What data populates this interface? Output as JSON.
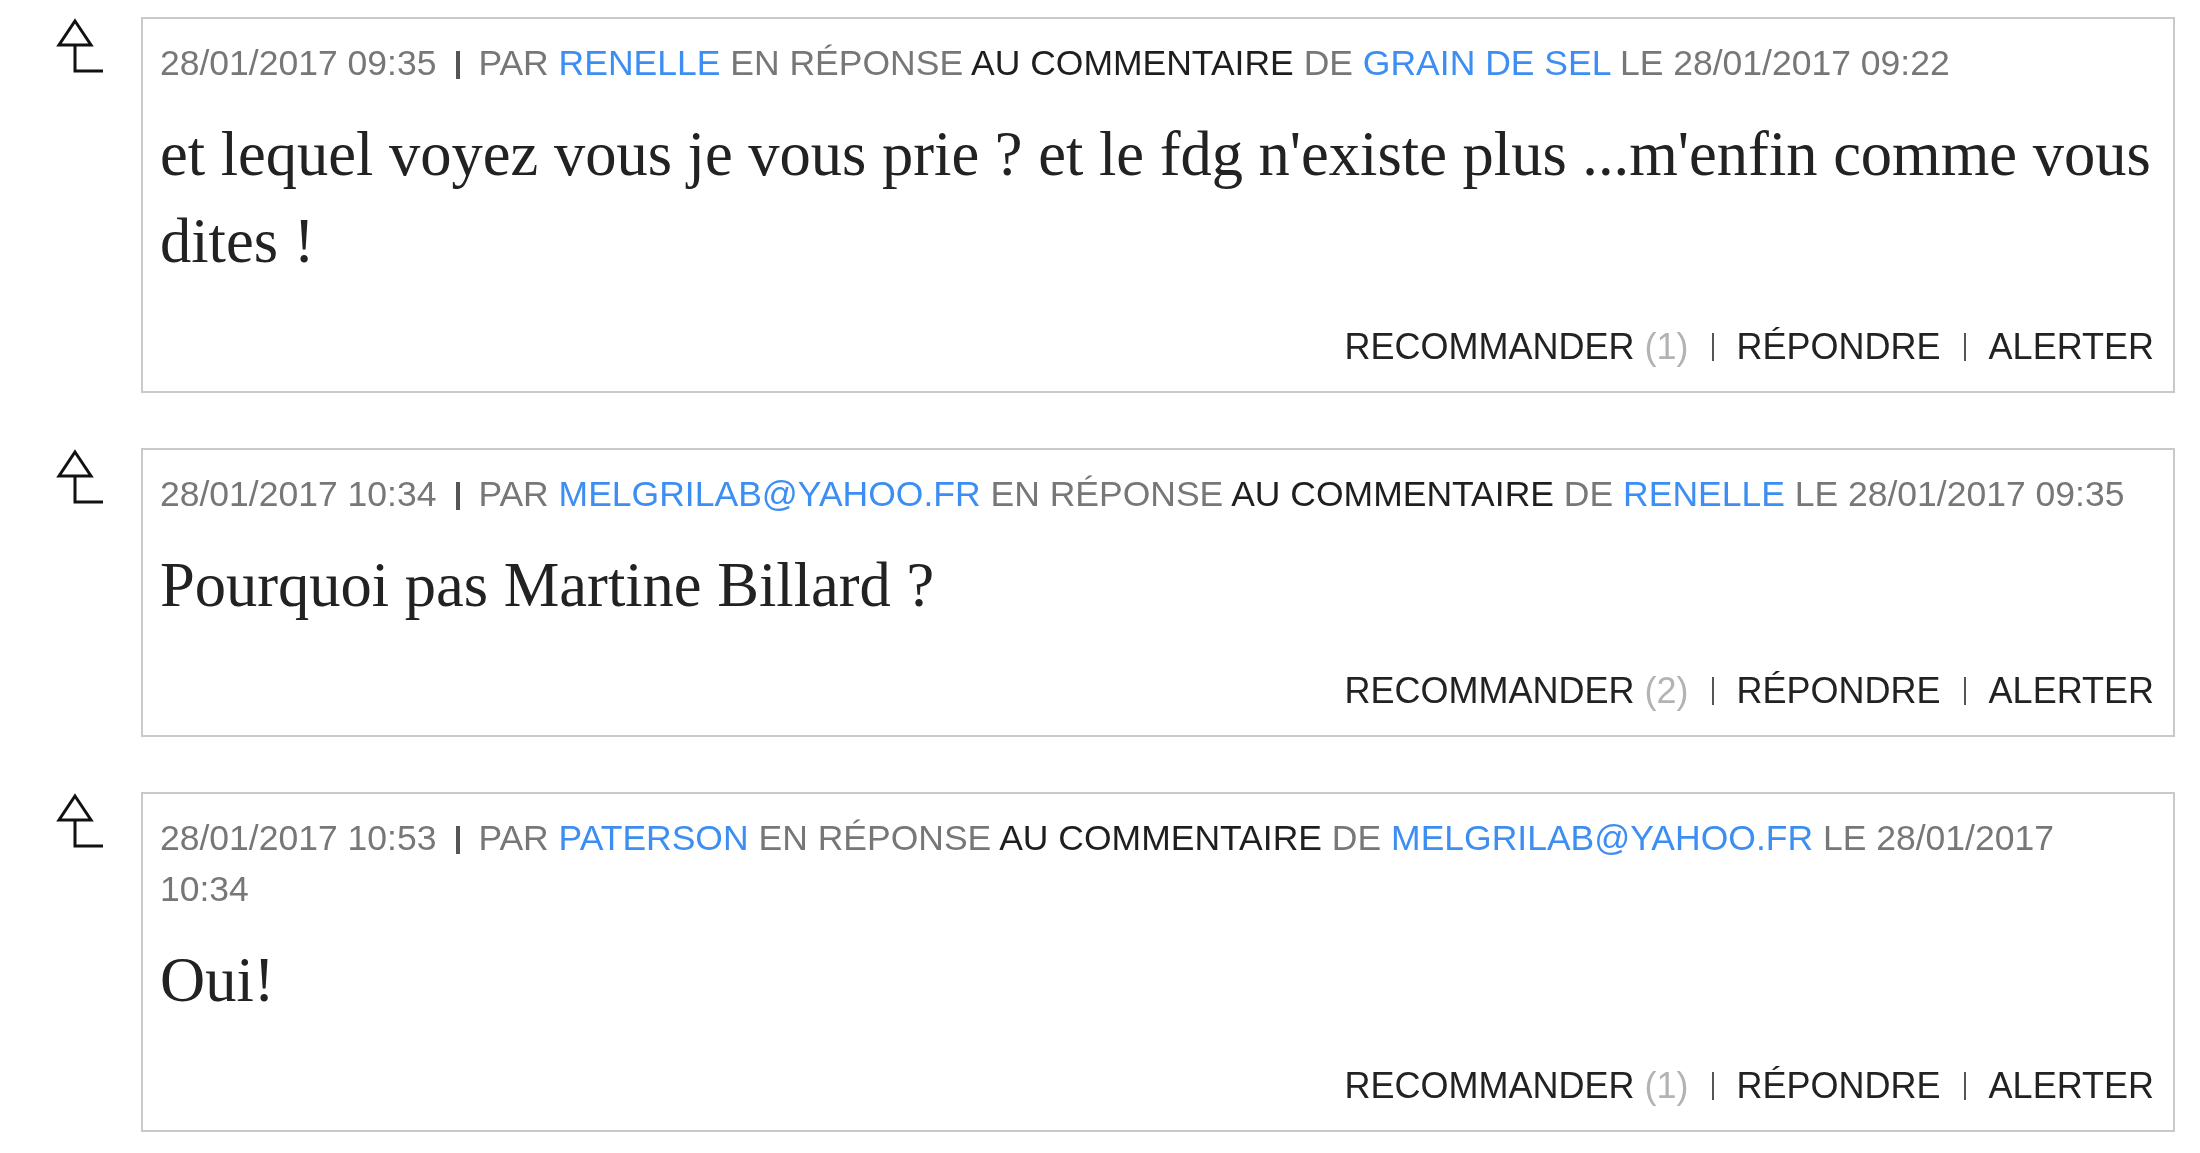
{
  "comments": [
    {
      "timestamp": "28/01/2017 09:35",
      "reply_info": [
        {
          "kind": "text",
          "text": "PAR"
        },
        {
          "kind": "user",
          "text": "RENELLE"
        },
        {
          "kind": "text",
          "text": "EN RÉPONSE"
        },
        {
          "kind": "link",
          "text": "AU COMMENTAIRE"
        },
        {
          "kind": "text",
          "text": "DE"
        },
        {
          "kind": "user",
          "text": "GRAIN DE SEL"
        },
        {
          "kind": "text",
          "text": "LE 28/01/2017 09:22"
        }
      ],
      "body": "et lequel voyez vous je vous prie ? et le fdg n'existe plus ...m'enfin comme vous dites !",
      "actions": [
        {
          "label": "RECOMMANDER",
          "count": "(1)"
        },
        {
          "label": "RÉPONDRE"
        },
        {
          "label": "ALERTER"
        }
      ]
    },
    {
      "timestamp": "28/01/2017 10:34",
      "reply_info": [
        {
          "kind": "text",
          "text": "PAR"
        },
        {
          "kind": "user",
          "text": "MELGRILAB@YAHOO.FR"
        },
        {
          "kind": "text",
          "text": "EN RÉPONSE"
        },
        {
          "kind": "link",
          "text": "AU COMMENTAIRE"
        },
        {
          "kind": "text",
          "text": "DE"
        },
        {
          "kind": "user",
          "text": "RENELLE"
        },
        {
          "kind": "text",
          "text": "LE 28/01/2017 09:35"
        }
      ],
      "body": "Pourquoi pas Martine Billard ?",
      "actions": [
        {
          "label": "RECOMMANDER",
          "count": "(2)"
        },
        {
          "label": "RÉPONDRE"
        },
        {
          "label": "ALERTER"
        }
      ]
    },
    {
      "timestamp": "28/01/2017 10:53",
      "reply_info": [
        {
          "kind": "text",
          "text": "PAR"
        },
        {
          "kind": "user",
          "text": "PATERSON"
        },
        {
          "kind": "text",
          "text": "EN RÉPONSE"
        },
        {
          "kind": "link",
          "text": "AU COMMENTAIRE"
        },
        {
          "kind": "text",
          "text": "DE"
        },
        {
          "kind": "user",
          "text": "MELGRILAB@YAHOO.FR"
        },
        {
          "kind": "text",
          "text": "LE 28/01/2017 10:34"
        }
      ],
      "body": "Oui!",
      "actions": [
        {
          "label": "RECOMMANDER",
          "count": "(1)"
        },
        {
          "label": "RÉPONDRE"
        },
        {
          "label": "ALERTER"
        }
      ]
    }
  ]
}
